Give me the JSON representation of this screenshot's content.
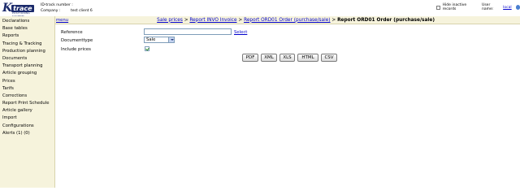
{
  "header": {
    "logo_text": "trace",
    "logo_tag": "POSITIONING SYSTEMS",
    "label_1": "ID-track number :",
    "label_2": "Company :",
    "company": "test client 6",
    "hide_inactive_label": "Hide inactive records",
    "user_name_label": "User name:",
    "user_name": "local"
  },
  "sidebar": {
    "items": [
      {
        "label": "Declarations"
      },
      {
        "label": "Base tables"
      },
      {
        "label": "Reports"
      },
      {
        "label": "Tracing & Tracking"
      },
      {
        "label": "Production planning"
      },
      {
        "label": "Documents"
      },
      {
        "label": "Transport planning"
      },
      {
        "label": "Article grouping"
      },
      {
        "label": "Prices"
      },
      {
        "label": "Tarifs"
      },
      {
        "label": "Corrections"
      },
      {
        "label": "Report Print Schedule"
      },
      {
        "label": "Article gallery"
      },
      {
        "label": "Import"
      },
      {
        "label": "Configurations"
      },
      {
        "label": "Alerts (1) (0)"
      }
    ]
  },
  "topbar": {
    "menu_label": "menu",
    "breadcrumb": {
      "link_1": "Sale prices",
      "link_2": "Report INVO Invoice",
      "link_3": "Report ORD01 Order (purchase/sale)",
      "current": "Report ORD01 Order (purchase/sale)",
      "separator": " > "
    }
  },
  "form": {
    "reference_label": "Reference",
    "reference_value": "",
    "select_link": "Select",
    "doctype_label": "Documenttype",
    "doctype_value": "Sale",
    "include_prices_label": "Include prices",
    "include_prices_checked": true
  },
  "buttons": {
    "pdf": "PDF",
    "xml": "XML",
    "xls": "XLS",
    "html": "HTML",
    "csv": "CSV"
  }
}
